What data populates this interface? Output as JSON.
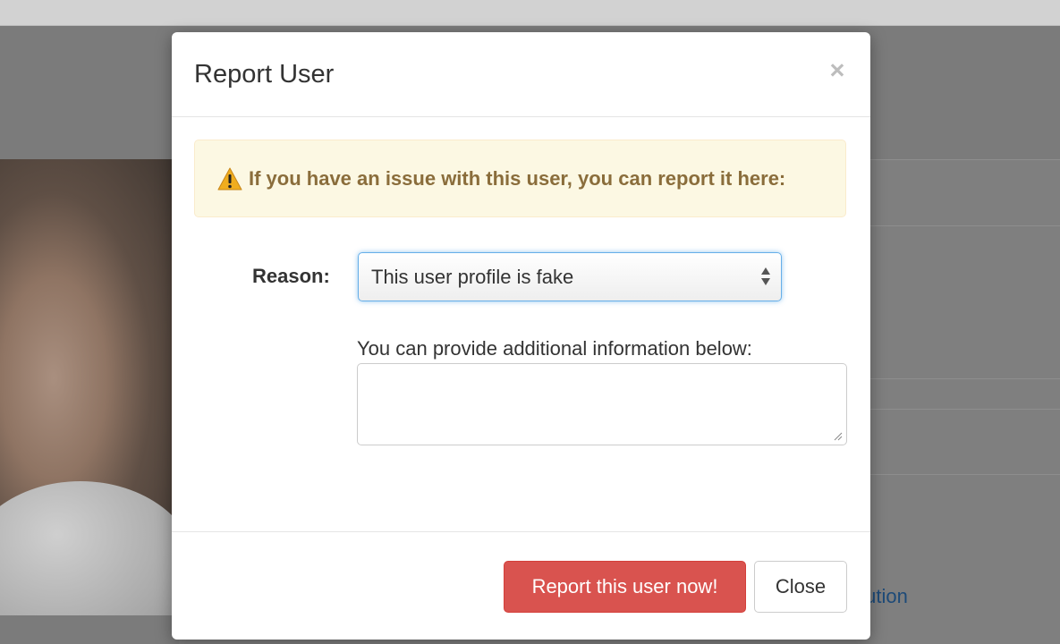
{
  "background": {
    "partial_link_text": "olution"
  },
  "modal": {
    "title": "Report User",
    "close_symbol": "×",
    "alert": {
      "icon": "warning-icon",
      "text": "If you have an issue with this user, you can report it here:"
    },
    "reason": {
      "label": "Reason:",
      "selected": "This user profile is fake"
    },
    "additional_info": {
      "label": "You can provide additional information below:",
      "value": ""
    },
    "buttons": {
      "report": "Report this user now!",
      "close": "Close"
    }
  },
  "colors": {
    "danger": "#d9534f",
    "alert_bg": "#fcf8e3",
    "alert_text": "#8a6d3b",
    "focus": "#66afe9"
  }
}
